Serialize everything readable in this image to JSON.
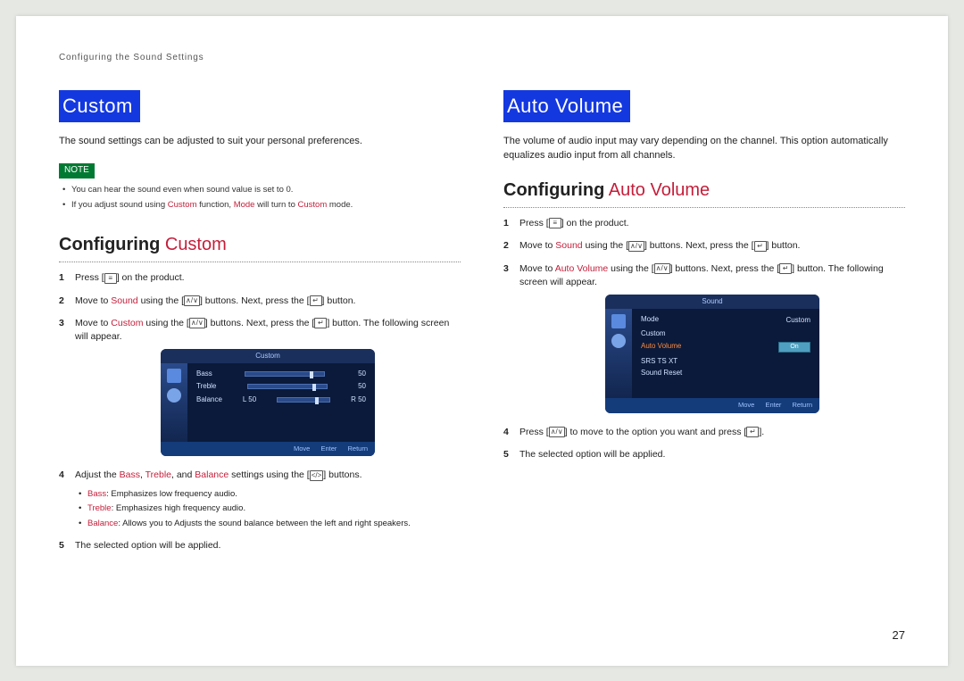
{
  "running_head": "Configuring the Sound Settings",
  "page_number": "27",
  "left": {
    "title": "Custom",
    "intro": "The sound settings can be adjusted to suit your personal preferences.",
    "note_label": "NOTE",
    "notes": {
      "n1": "You can hear the sound even when sound value is set to 0.",
      "n2_a": "If you adjust sound using ",
      "n2_b": "Custom",
      "n2_c": " function, ",
      "n2_d": "Mode",
      "n2_e": " will turn to ",
      "n2_f": "Custom",
      "n2_g": " mode."
    },
    "subhead_a": "Configuring",
    "subhead_b": " Custom",
    "steps": {
      "s1_a": "Press [",
      "s1_icon": "MENU",
      "s1_b": "] on the product.",
      "s2_a": "Move to ",
      "s2_b": "Sound",
      "s2_c": " using the [",
      "s2_icon": "∧/∨",
      "s2_d": "] buttons. Next, press the [",
      "s2_icon2": "↵",
      "s2_e": "] button.",
      "s3_a": "Move to ",
      "s3_b": "Custom",
      "s3_c": " using the [",
      "s3_icon": "∧/∨",
      "s3_d": "] buttons. Next, press the [",
      "s3_icon2": "↵",
      "s3_e": "] button. The following screen will appear.",
      "s4_a": "Adjust the ",
      "s4_b": "Bass",
      "s4_c": ", ",
      "s4_d": "Treble",
      "s4_e": ", and ",
      "s4_f": "Balance",
      "s4_g": " settings using the [",
      "s4_icon": "</>",
      "s4_h": "] buttons.",
      "s5": "The selected option will be applied."
    },
    "bullets": {
      "b1_a": "Bass",
      "b1_b": ": Emphasizes low frequency audio.",
      "b2_a": "Treble",
      "b2_b": ": Emphasizes high frequency audio.",
      "b3_a": "Balance",
      "b3_b": ": Allows you to Adjusts the sound balance between the left and right speakers."
    },
    "screenshot": {
      "title": "Custom",
      "rows": {
        "bass": "Bass",
        "bass_v": "50",
        "treble": "Treble",
        "treble_v": "50",
        "bal": "Balance",
        "bal_l": "L 50",
        "bal_r": "R 50"
      },
      "footer": {
        "move": "Move",
        "enter": "Enter",
        "ret": "Return"
      }
    }
  },
  "right": {
    "title": "Auto Volume",
    "intro": "The volume of audio input may vary depending on the channel. This option automatically equalizes audio input from all channels.",
    "subhead_a": "Configuring",
    "subhead_b": " Auto Volume",
    "steps": {
      "s1_a": "Press [",
      "s1_icon": "MENU",
      "s1_b": "] on the product.",
      "s2_a": "Move to ",
      "s2_b": "Sound",
      "s2_c": " using the [",
      "s2_icon": "∧/∨",
      "s2_d": "] buttons. Next, press the [",
      "s2_icon2": "↵",
      "s2_e": "] button.",
      "s3_a": "Move to ",
      "s3_b": "Auto Volume",
      "s3_c": " using the [",
      "s3_icon": "∧/∨",
      "s3_d": "] buttons. Next, press the [",
      "s3_icon2": "↵",
      "s3_e": "] button. The following screen will appear.",
      "s4_a": "Press [",
      "s4_icon": "∧/∨",
      "s4_b": "] to move to the option you want and press [",
      "s4_icon2": "↵",
      "s4_c": "].",
      "s5": "The selected option will be applied."
    },
    "screenshot": {
      "title": "Sound",
      "opts": {
        "mode": "Mode",
        "mode_v": "Custom",
        "custom": "Custom",
        "auto": "Auto Volume",
        "auto_v": "On",
        "srs": "SRS TS XT",
        "reset": "Sound Reset"
      },
      "footer": {
        "move": "Move",
        "enter": "Enter",
        "ret": "Return"
      }
    }
  }
}
